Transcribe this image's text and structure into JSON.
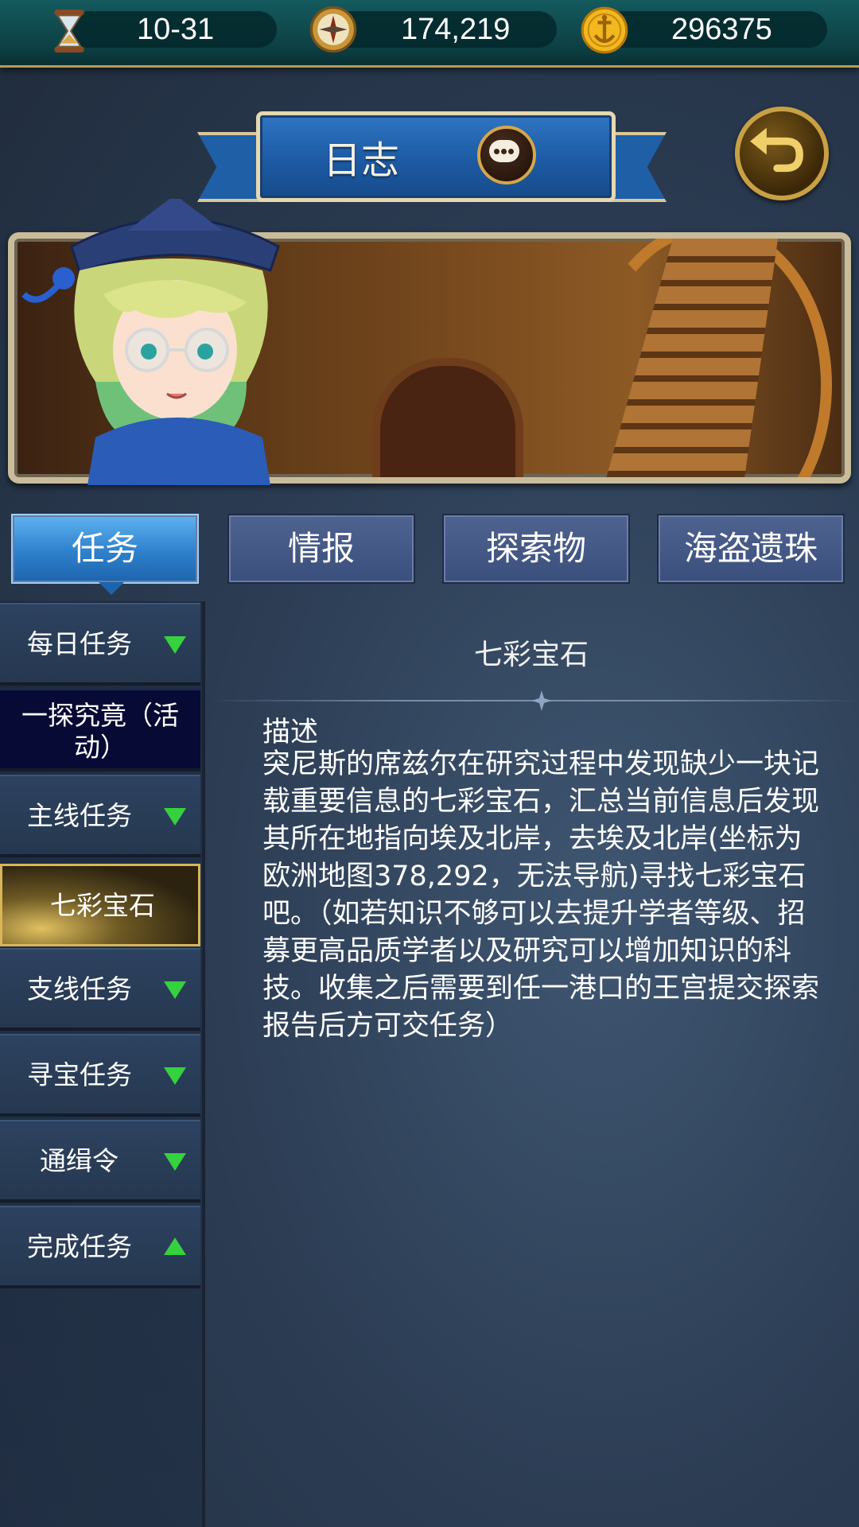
{
  "topbar": {
    "date": "10-31",
    "compass_value": "174,219",
    "gold_value": "296375"
  },
  "header": {
    "title": "日志"
  },
  "tabs": [
    {
      "label": "任务",
      "active": true
    },
    {
      "label": "情报",
      "active": false
    },
    {
      "label": "探索物",
      "active": false
    },
    {
      "label": "海盗遗珠",
      "active": false
    }
  ],
  "categories": [
    {
      "label": "每日任务",
      "arrow": "down"
    },
    {
      "label": "一探究竟（活动）"
    },
    {
      "label": "主线任务",
      "arrow": "down"
    },
    {
      "label": "七彩宝石",
      "selected": true
    },
    {
      "label": "支线任务",
      "arrow": "down"
    },
    {
      "label": "寻宝任务",
      "arrow": "down"
    },
    {
      "label": "通缉令",
      "arrow": "down"
    },
    {
      "label": "完成任务",
      "arrow": "up"
    }
  ],
  "quest": {
    "title": "七彩宝石",
    "description_heading": "描述",
    "description": "突尼斯的席兹尔在研究过程中发现缺少一块记载重要信息的七彩宝石，汇总当前信息后发现其所在地指向埃及北岸，去埃及北岸(坐标为欧洲地图378,292，无法导航)寻找七彩宝石吧。（如若知识不够可以去提升学者等级、招募更高品质学者以及研究可以增加知识的科技。收集之后需要到任一港口的王宫提交探索报告后方可交任务）"
  },
  "colors": {
    "accent_green": "#35d13f",
    "active_tab_blue": "#2f80cc",
    "gold_border": "#d7b65a"
  },
  "icons": [
    "hourglass-icon",
    "compass-icon",
    "gold-anchor-coin-icon",
    "chat-bubble-icon",
    "back-arrow-icon"
  ]
}
